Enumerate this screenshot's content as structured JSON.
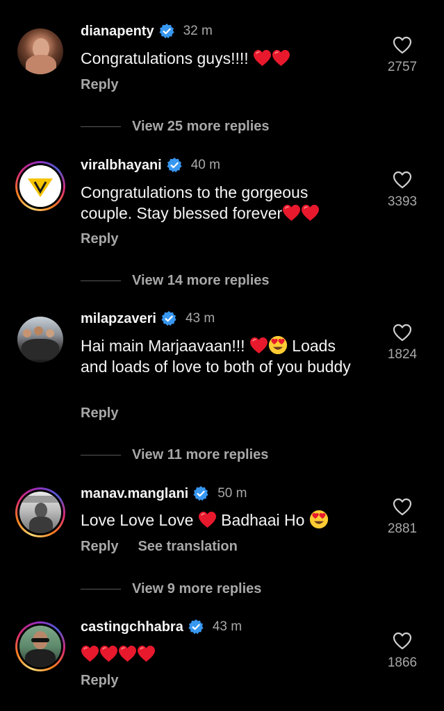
{
  "colors": {
    "background": "#000000",
    "text": "#f5f5f5",
    "secondary_text": "#a8a8a8",
    "verified_badge": "#3897f0",
    "heart_emoji": "#e8192c"
  },
  "comments": [
    {
      "username": "dianapenty",
      "time": "32 m",
      "text_before": "Congratulations guys!!!! ",
      "reply_label": "Reply",
      "like_count": "2757",
      "view_replies": "View 25 more replies"
    },
    {
      "username": "viralbhayani",
      "time": "40 m",
      "text_before": "Congratulations to the gorgeous couple. Stay blessed forever",
      "reply_label": "Reply",
      "like_count": "3393",
      "view_replies": "View 14 more replies"
    },
    {
      "username": "milapzaveri",
      "time": "43 m",
      "text_before": "Hai main Marjaavaan!!! ",
      "text_after": " Loads and loads of love to both of you buddy",
      "reply_label": "Reply",
      "like_count": "1824",
      "view_replies": "View 11 more replies"
    },
    {
      "username": "manav.manglani",
      "time": "50 m",
      "text_before": "Love Love Love ",
      "text_middle": " Badhaai Ho ",
      "reply_label": "Reply",
      "translate_label": "See translation",
      "like_count": "2881",
      "view_replies": "View 9 more replies"
    },
    {
      "username": "castingchhabra",
      "time": "43 m",
      "reply_label": "Reply",
      "like_count": "1866"
    }
  ]
}
